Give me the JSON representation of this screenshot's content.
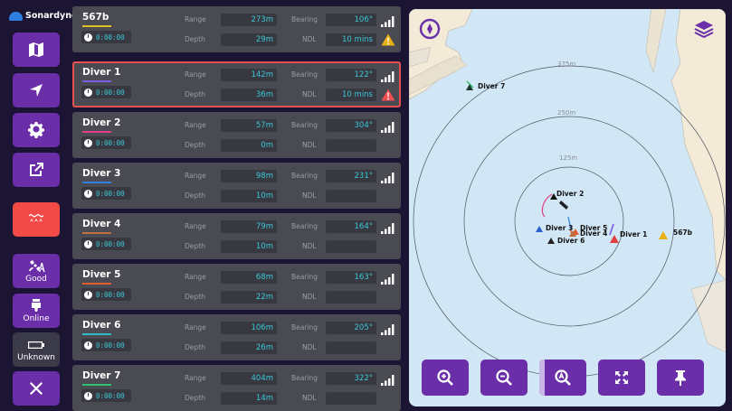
{
  "brand": {
    "name": "Sonardyne"
  },
  "sidebar": {
    "status": [
      {
        "label": "Good",
        "icon": "gps-signal-icon"
      },
      {
        "label": "Online",
        "icon": "transceiver-icon"
      },
      {
        "label": "Unknown",
        "icon": "battery-icon"
      }
    ]
  },
  "labels": {
    "range": "Range",
    "bearing": "Bearing",
    "depth": "Depth",
    "ndl": "NDL"
  },
  "divers": [
    {
      "name": "567b",
      "time": "0:00:00",
      "range": "273m",
      "bearing": "106°",
      "depth": "29m",
      "ndl": "10 mins",
      "color": "#e0c020",
      "warn": "yellow",
      "selected": false
    },
    {
      "name": "Diver 1",
      "time": "0:00:00",
      "range": "142m",
      "bearing": "122°",
      "depth": "36m",
      "ndl": "10 mins",
      "color": "#7c5ce0",
      "warn": "red",
      "selected": true
    },
    {
      "name": "Diver 2",
      "time": "0:00:00",
      "range": "57m",
      "bearing": "304°",
      "depth": "0m",
      "ndl": "",
      "color": "#e0408a",
      "warn": "",
      "selected": false
    },
    {
      "name": "Diver 3",
      "time": "0:00:00",
      "range": "98m",
      "bearing": "231°",
      "depth": "10m",
      "ndl": "",
      "color": "#3080e0",
      "warn": "",
      "selected": false
    },
    {
      "name": "Diver 4",
      "time": "0:00:00",
      "range": "79m",
      "bearing": "164°",
      "depth": "10m",
      "ndl": "",
      "color": "#c07040",
      "warn": "",
      "selected": false
    },
    {
      "name": "Diver 5",
      "time": "0:00:00",
      "range": "68m",
      "bearing": "163°",
      "depth": "22m",
      "ndl": "",
      "color": "#e06030",
      "warn": "",
      "selected": false
    },
    {
      "name": "Diver 6",
      "time": "0:00:00",
      "range": "106m",
      "bearing": "205°",
      "depth": "26m",
      "ndl": "",
      "color": "#30b8c8",
      "warn": "",
      "selected": false
    },
    {
      "name": "Diver 7",
      "time": "0:00:00",
      "range": "404m",
      "bearing": "322°",
      "depth": "14m",
      "ndl": "",
      "color": "#30c070",
      "warn": "",
      "selected": false
    }
  ],
  "map": {
    "rings": [
      "375m",
      "250m",
      "125m"
    ],
    "markers": [
      "Diver 7",
      "Diver 2",
      "Diver 3",
      "Diver 5",
      "Diver 4",
      "Diver 6",
      "Diver 1",
      "567b"
    ]
  },
  "colors": {
    "accent": "#6a2fa8",
    "alert": "#f24b47",
    "value": "#3ac9d8",
    "map_water": "#d2e7f6",
    "map_land": "#f3ead8"
  }
}
